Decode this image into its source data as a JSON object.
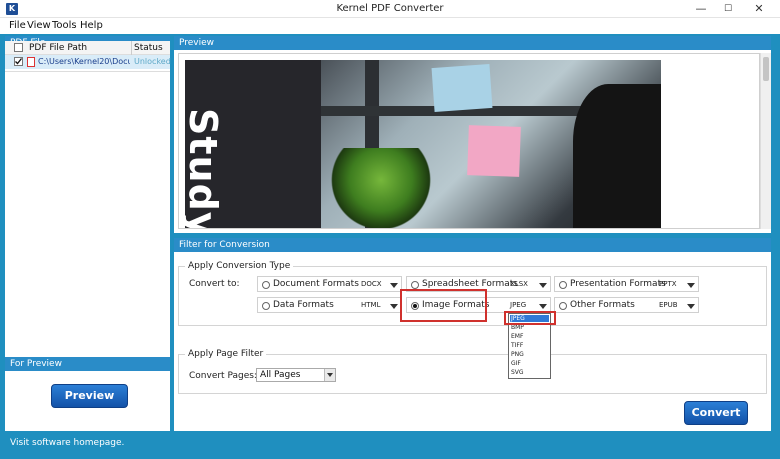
{
  "window": {
    "title": "Kernel PDF Converter",
    "app_icon_letter": "K",
    "minimize_glyph": "—",
    "maximize_glyph": "☐",
    "close_glyph": "✕"
  },
  "menu": [
    "File",
    "View",
    "Tools",
    "Help"
  ],
  "pdf_panel": {
    "title": "PDF File",
    "toolbar_icons": [
      "add-pdf-icon",
      "add-folder-icon",
      "remove-pdf-icon",
      "remove-all-icon",
      "unlock-icon"
    ],
    "columns": [
      "PDF File Path",
      "Status"
    ],
    "rows": [
      {
        "checked": true,
        "path": "C:\\Users\\Kernel20\\Docu...",
        "status": "Unlocked"
      }
    ]
  },
  "for_preview": {
    "title": "For Preview",
    "button": "Preview"
  },
  "preview": {
    "title": "Preview",
    "page_text": "Study"
  },
  "filter": {
    "title": "Filter for Conversion",
    "conversion_type": {
      "group_title": "Apply Conversion Type",
      "convert_to_label": "Convert to:",
      "formats": [
        {
          "label": "Document Formats",
          "value": "DOCX",
          "selected": false
        },
        {
          "label": "Spreadsheet Formats",
          "value": "XLSX",
          "selected": false
        },
        {
          "label": "Presentation Formats",
          "value": "PPTX",
          "selected": false
        },
        {
          "label": "Data Formats",
          "value": "HTML",
          "selected": false
        },
        {
          "label": "Image Formats",
          "value": "JPEG",
          "selected": true
        },
        {
          "label": "Other Formats",
          "value": "EPUB",
          "selected": false
        }
      ],
      "image_dropdown_options": [
        "JPEG",
        "BMP",
        "EMF",
        "TIFF",
        "PNG",
        "GIF",
        "SVG"
      ],
      "image_dropdown_selected": "JPEG"
    },
    "page_filter": {
      "group_title": "Apply Page Filter",
      "convert_pages_label": "Convert Pages:",
      "selected": "All Pages"
    },
    "convert_button": "Convert"
  },
  "statusbar": {
    "text": "Visit software homepage."
  },
  "colors": {
    "accent": "#1f8fbf",
    "panel_header": "#2a8cc8",
    "button": "#1352a8",
    "highlight_red": "#d0312d"
  }
}
